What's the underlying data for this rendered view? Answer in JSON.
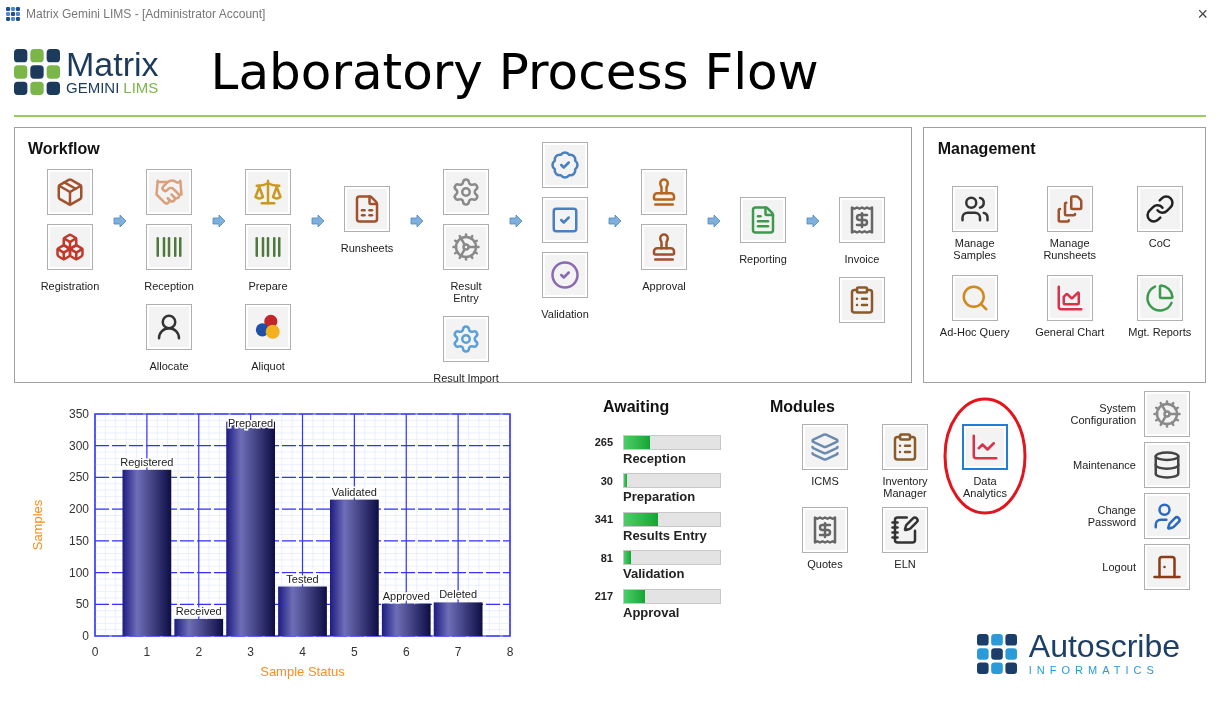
{
  "window": {
    "title": "Matrix Gemini LIMS - [Administrator Account]",
    "close": "×"
  },
  "header": {
    "logo": {
      "name": "Matrix",
      "sub1": "GEMINI",
      "sub2": "LIMS"
    },
    "title": "Laboratory Process Flow"
  },
  "workflow": {
    "title": "Workflow",
    "columns": [
      {
        "groups": [
          {
            "label": "Registration"
          }
        ]
      },
      {
        "groups": [
          {
            "label": "Reception"
          },
          {
            "label": "Allocate"
          }
        ]
      },
      {
        "groups": [
          {
            "label": "Prepare"
          },
          {
            "label": "Aliquot"
          }
        ]
      },
      {
        "groups": [
          {
            "label": "Runsheets"
          }
        ]
      },
      {
        "groups": [
          {
            "label": "Result\nEntry"
          },
          {
            "label": "Result Import"
          }
        ]
      },
      {
        "groups": [
          {
            "label": "Validation"
          }
        ]
      },
      {
        "groups": [
          {
            "label": "Approval"
          }
        ]
      },
      {
        "groups": [
          {
            "label": "Reporting"
          }
        ]
      },
      {
        "groups": [
          {
            "label": "Invoice"
          }
        ]
      }
    ]
  },
  "management": {
    "title": "Management",
    "items": [
      {
        "label": "Manage\nSamples"
      },
      {
        "label": "Manage\nRunsheets"
      },
      {
        "label": "CoC"
      },
      {
        "label": "Ad-Hoc Query"
      },
      {
        "label": "General Chart"
      },
      {
        "label": "Mgt. Reports"
      }
    ]
  },
  "chart": {
    "chart_data": {
      "type": "bar",
      "xlabel": "Sample Status",
      "ylabel": "Samples",
      "x": [
        1,
        2,
        3,
        4,
        5,
        6,
        7
      ],
      "grid": true,
      "series": [
        {
          "color": "#1c1c80",
          "values": [
            262,
            27,
            338,
            78,
            215,
            51,
            53
          ]
        }
      ],
      "xlim": [
        0,
        8
      ],
      "ylim": [
        0,
        350
      ],
      "xticks": [
        0,
        1,
        2,
        3,
        4,
        5,
        6,
        7,
        8
      ],
      "yticks": [
        0,
        50,
        100,
        150,
        200,
        250,
        300,
        350
      ],
      "value_labels": [
        "Registered",
        "Received",
        "Prepared",
        "Tested",
        "Validated",
        "Approved",
        "Deleted"
      ]
    }
  },
  "awaiting": {
    "title": "Awaiting",
    "rows": [
      {
        "count": "265",
        "label": "Reception",
        "level": 0.27
      },
      {
        "count": "30",
        "label": "Preparation",
        "level": 0.03
      },
      {
        "count": "341",
        "label": "Results Entry",
        "level": 0.35
      },
      {
        "count": "81",
        "label": "Validation",
        "level": 0.07
      },
      {
        "count": "217",
        "label": "Approval",
        "level": 0.22
      }
    ]
  },
  "modules": {
    "title": "Modules",
    "items": [
      {
        "label": "ICMS",
        "selected": false,
        "highlighted": false
      },
      {
        "label": "Inventory\nManager",
        "selected": false,
        "highlighted": false
      },
      {
        "label": "Data\nAnalytics",
        "selected": true,
        "highlighted": true
      },
      {
        "label": "Quotes",
        "selected": false,
        "highlighted": false
      },
      {
        "label": "ELN",
        "selected": false,
        "highlighted": false
      }
    ]
  },
  "system": {
    "items": [
      {
        "label": "System\nConfiguration"
      },
      {
        "label": "Maintenance"
      },
      {
        "label": "Change\nPassword"
      },
      {
        "label": "Logout"
      }
    ]
  },
  "footer": {
    "brand": "Autoscribe",
    "tagline": "INFORMATICS"
  }
}
